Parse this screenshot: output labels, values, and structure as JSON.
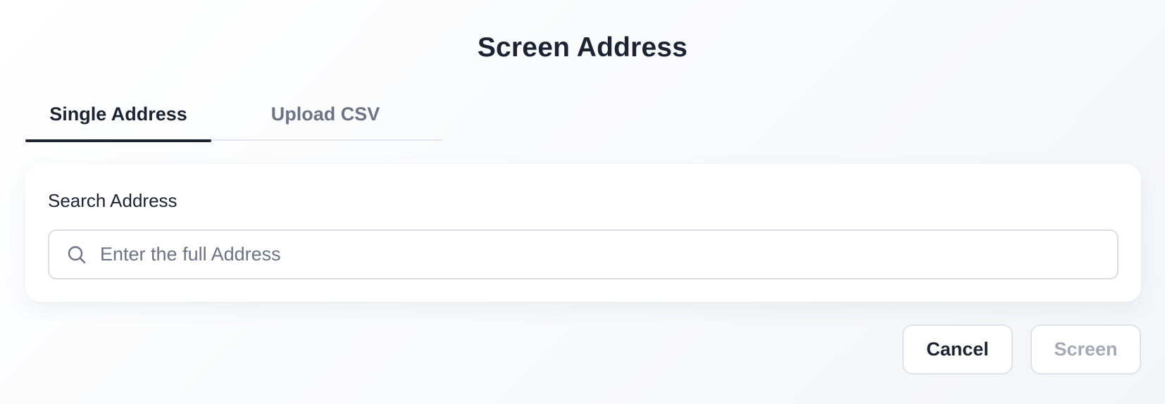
{
  "dialog": {
    "title": "Screen Address"
  },
  "tabs": [
    {
      "label": "Single Address",
      "active": true
    },
    {
      "label": "Upload CSV",
      "active": false
    }
  ],
  "search": {
    "label": "Search Address",
    "placeholder": "Enter the full Address",
    "value": "",
    "icon": "search-icon"
  },
  "actions": {
    "cancel_label": "Cancel",
    "screen_label": "Screen",
    "screen_disabled": true
  },
  "colors": {
    "primary_text": "#1c2434",
    "muted_text": "#6b7385",
    "disabled_text": "#a4aab6",
    "border": "#d9dce2"
  }
}
